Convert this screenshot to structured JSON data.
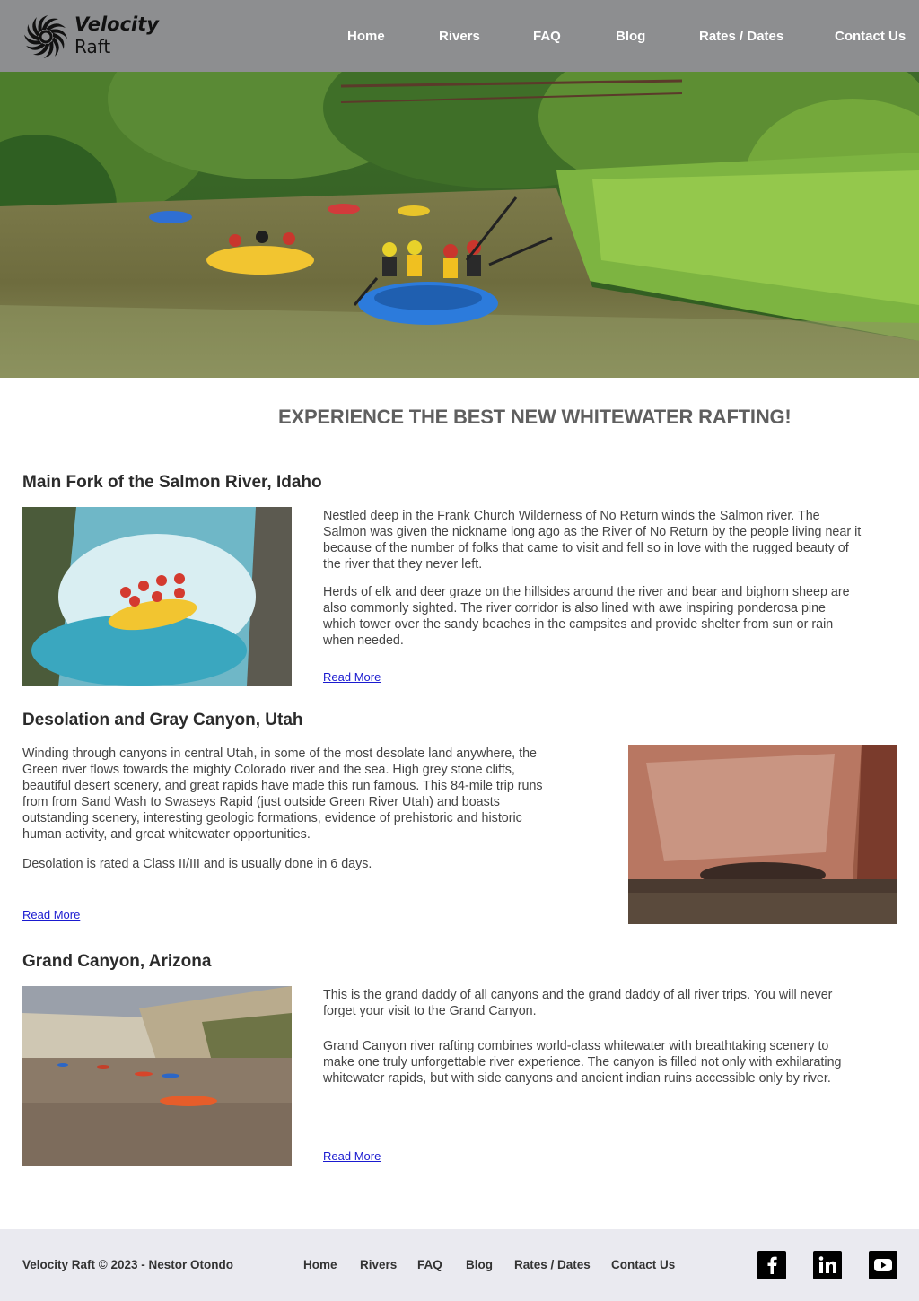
{
  "brand": {
    "line1": "Velocity",
    "line2": "Raft"
  },
  "nav": [
    "Home",
    "Rivers",
    "FAQ",
    "Blog",
    "Rates / Dates",
    "Contact Us"
  ],
  "tagline": "EXPERIENCE THE BEST NEW WHITEWATER RAFTING!",
  "rivers": [
    {
      "title": "Main Fork of the Salmon River, Idaho",
      "paragraphs": [
        "Nestled deep in the Frank Church Wilderness of No Return winds the Salmon river. The Salmon was given the nickname long ago as the River of No Return by the people living near it because of the number of folks that came to visit and fell so in love with the rugged beauty of the river that they never left.",
        "Herds of elk and deer graze on the hillsides around the river and bear and bighorn sheep are also commonly sighted. The river corridor is also lined with awe inspiring ponderosa pine which tower over the sandy beaches in the campsites and provide shelter from sun or rain when needed."
      ],
      "link": "Read More"
    },
    {
      "title": "Desolation and Gray Canyon, Utah",
      "paragraphs": [
        "Winding through canyons in central Utah, in some of the most desolate land anywhere, the Green river flows towards the mighty Colorado river and the sea. High grey stone cliffs, beautiful desert scenery, and great rapids have made this run famous. This 84-mile trip runs from from Sand Wash to Swaseys Rapid (just outside Green River Utah) and boasts outstanding scenery, interesting geologic formations, evidence of prehistoric and historic human activity, and great whitewater opportunities.",
        "Desolation is rated a Class II/III and is usually done in 6 days."
      ],
      "link": "Read More"
    },
    {
      "title": "Grand Canyon, Arizona",
      "paragraphs": [
        "This is the grand daddy of all canyons and the grand daddy of all river trips. You will never forget your visit to the Grand Canyon.",
        "Grand Canyon river rafting combines world-class whitewater with breathtaking scenery to make one truly unforgettable river experience. The canyon is filled not only with exhilarating whitewater rapids, but with side canyons and ancient indian ruins accessible only by river."
      ],
      "link": "Read More"
    }
  ],
  "footer": {
    "copyright": "Velocity Raft © 2023 - Nestor Otondo",
    "nav": [
      "Home",
      "Rivers",
      "FAQ",
      "Blog",
      "Rates / Dates",
      "Contact Us"
    ],
    "social": [
      "facebook-icon",
      "linkedin-icon",
      "youtube-icon"
    ]
  }
}
